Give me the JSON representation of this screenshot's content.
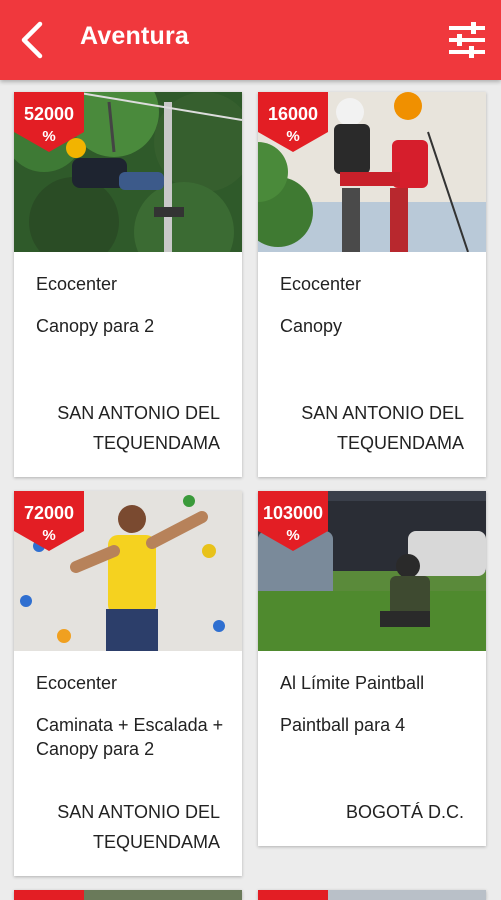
{
  "header": {
    "title": "Aventura",
    "back_icon": "chevron-left-icon",
    "filter_icon": "sliders-icon",
    "color": "#f0383d"
  },
  "cards": [
    {
      "badge_value": "52000",
      "badge_unit": "%",
      "company": "Ecocenter",
      "product": "Canopy para 2",
      "location": "SAN ANTONIO DEL TEQUENDAMA"
    },
    {
      "badge_value": "16000",
      "badge_unit": "%",
      "company": "Ecocenter",
      "product": "Canopy",
      "location": "SAN ANTONIO DEL TEQUENDAMA"
    },
    {
      "badge_value": "72000",
      "badge_unit": "%",
      "company": "Ecocenter",
      "product": "Caminata + Escalada + Canopy para 2",
      "location": "SAN ANTONIO DEL TEQUENDAMA"
    },
    {
      "badge_value": "103000",
      "badge_unit": "%",
      "company": "Al Límite Paintball",
      "product": "Paintball para 4",
      "location": "BOGOTÁ D.C."
    }
  ]
}
